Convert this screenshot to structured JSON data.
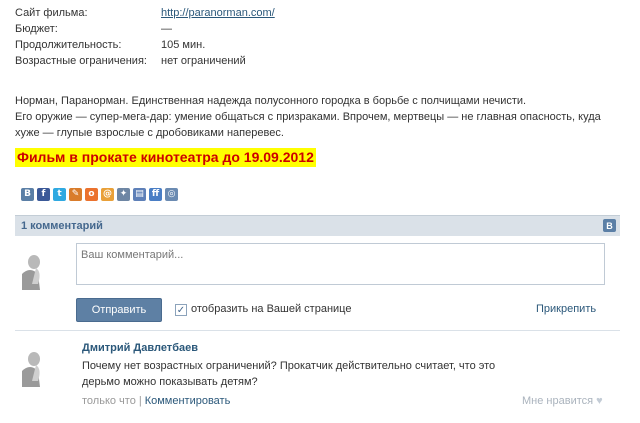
{
  "info": {
    "rows": [
      {
        "label": "Сайт фильма:",
        "value": "http://paranorman.com/"
      },
      {
        "label": "Бюджет:",
        "value": "—"
      },
      {
        "label": "Продолжительность:",
        "value": "105 мин."
      },
      {
        "label": "Возрастные ограничения:",
        "value": "нет ограничений"
      }
    ]
  },
  "description": {
    "line1": "Норман, Паранорман. Единственная надежда полусонного городка в борьбе с полчищами нечисти.",
    "line2": "Его оружие — супер-мега-дар: умение общаться с призраками. Впрочем, мертвецы — не главная опасность, куда хуже — глупые взрослые с дробовиками наперевес."
  },
  "premiere": "Фильм в прокате кинотеатра до 19.09.2012",
  "share": {
    "buttons": [
      {
        "icon": "vk-icon",
        "glyph": "B",
        "color": "#5b7fa6"
      },
      {
        "icon": "facebook-icon",
        "glyph": "f",
        "color": "#3b5998"
      },
      {
        "icon": "twitter-icon",
        "glyph": "t",
        "color": "#2fa9e1"
      },
      {
        "icon": "livejournal-icon",
        "glyph": "✎",
        "color": "#d97c2b"
      },
      {
        "icon": "odnoklassniki-icon",
        "glyph": "o",
        "color": "#eb722e"
      },
      {
        "icon": "mailru-icon",
        "glyph": "@",
        "color": "#e9a038"
      },
      {
        "icon": "bookmark-icon",
        "glyph": "✦",
        "color": "#6e86a4"
      },
      {
        "icon": "blog-icon",
        "glyph": "▤",
        "color": "#5e80b8"
      },
      {
        "icon": "friendfeed-icon",
        "glyph": "ff",
        "color": "#4a7ec5"
      },
      {
        "icon": "share-more-icon",
        "glyph": "◎",
        "color": "#6b8bb2"
      }
    ]
  },
  "comments": {
    "count_label": "1 комментарий",
    "vk_badge": "В",
    "placeholder": "Ваш комментарий...",
    "send_label": "Отправить",
    "checkbox_label": "отобразить на Вашей странице",
    "attach_label": "Прикрепить",
    "items": [
      {
        "author": "Дмитрий Давлетбаев",
        "text_line1": "Почему нет возрастных ограничений? Прокатчик действительно считает, что это",
        "text_line2": "дерьмо можно показывать детям?",
        "time": "только что",
        "reply": "Комментировать",
        "like": "Мне нравится"
      }
    ]
  }
}
